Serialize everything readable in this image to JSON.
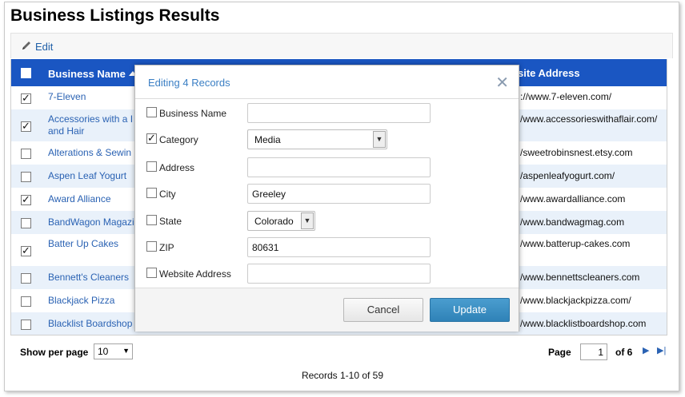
{
  "page": {
    "title": "Business Listings Results"
  },
  "toolbar": {
    "edit_label": "Edit"
  },
  "grid": {
    "columns": {
      "name": "Business Name",
      "website": "site Address"
    },
    "rows": [
      {
        "name": "7-Eleven",
        "website": "://www.7-eleven.com/",
        "checked": true
      },
      {
        "name": "Accessories with a I and Hair",
        "website": "/www.accessorieswithaflair.com/",
        "checked": true
      },
      {
        "name": "Alterations & Sewin",
        "website": "/sweetrobinsnest.etsy.com",
        "checked": false
      },
      {
        "name": "Aspen Leaf Yogurt",
        "website": "/aspenleafyogurt.com/",
        "checked": false
      },
      {
        "name": "Award Alliance",
        "website": "/www.awardalliance.com",
        "checked": true
      },
      {
        "name": "BandWagon Magazi",
        "website": "/www.bandwagmag.com",
        "checked": false
      },
      {
        "name": "Batter Up Cakes",
        "website": "/www.batterup-cakes.com",
        "checked": true
      },
      {
        "name": "Bennett's Cleaners",
        "website": "/www.bennettscleaners.com",
        "checked": false
      },
      {
        "name": "Blackjack Pizza",
        "website": "/www.blackjackpizza.com/",
        "checked": false
      },
      {
        "name": "Blacklist Boardshop",
        "website": "/www.blacklistboardshop.com",
        "checked": false
      }
    ]
  },
  "pager": {
    "show_per_page_label": "Show per page",
    "per_page_value": "10",
    "page_label": "Page",
    "current_page": "1",
    "of_label": "of 6",
    "records_text": "Records 1-10 of 59"
  },
  "modal": {
    "title": "Editing 4 Records",
    "fields": {
      "business_name": {
        "label": "Business Name",
        "value": "",
        "checked": false
      },
      "category": {
        "label": "Category",
        "value": "Media",
        "checked": true
      },
      "address": {
        "label": "Address",
        "value": "",
        "checked": false
      },
      "city": {
        "label": "City",
        "value": "Greeley",
        "checked": false
      },
      "state": {
        "label": "State",
        "value": "Colorado",
        "checked": false
      },
      "zip": {
        "label": "ZIP",
        "value": "80631",
        "checked": false
      },
      "website": {
        "label": "Website Address",
        "value": "",
        "checked": false
      }
    },
    "cancel_label": "Cancel",
    "update_label": "Update"
  },
  "colors": {
    "header_blue": "#1a56c2",
    "link_blue": "#2a62b3",
    "update_button": "#3a8dc2",
    "alt_row": "#e9f1fa"
  }
}
